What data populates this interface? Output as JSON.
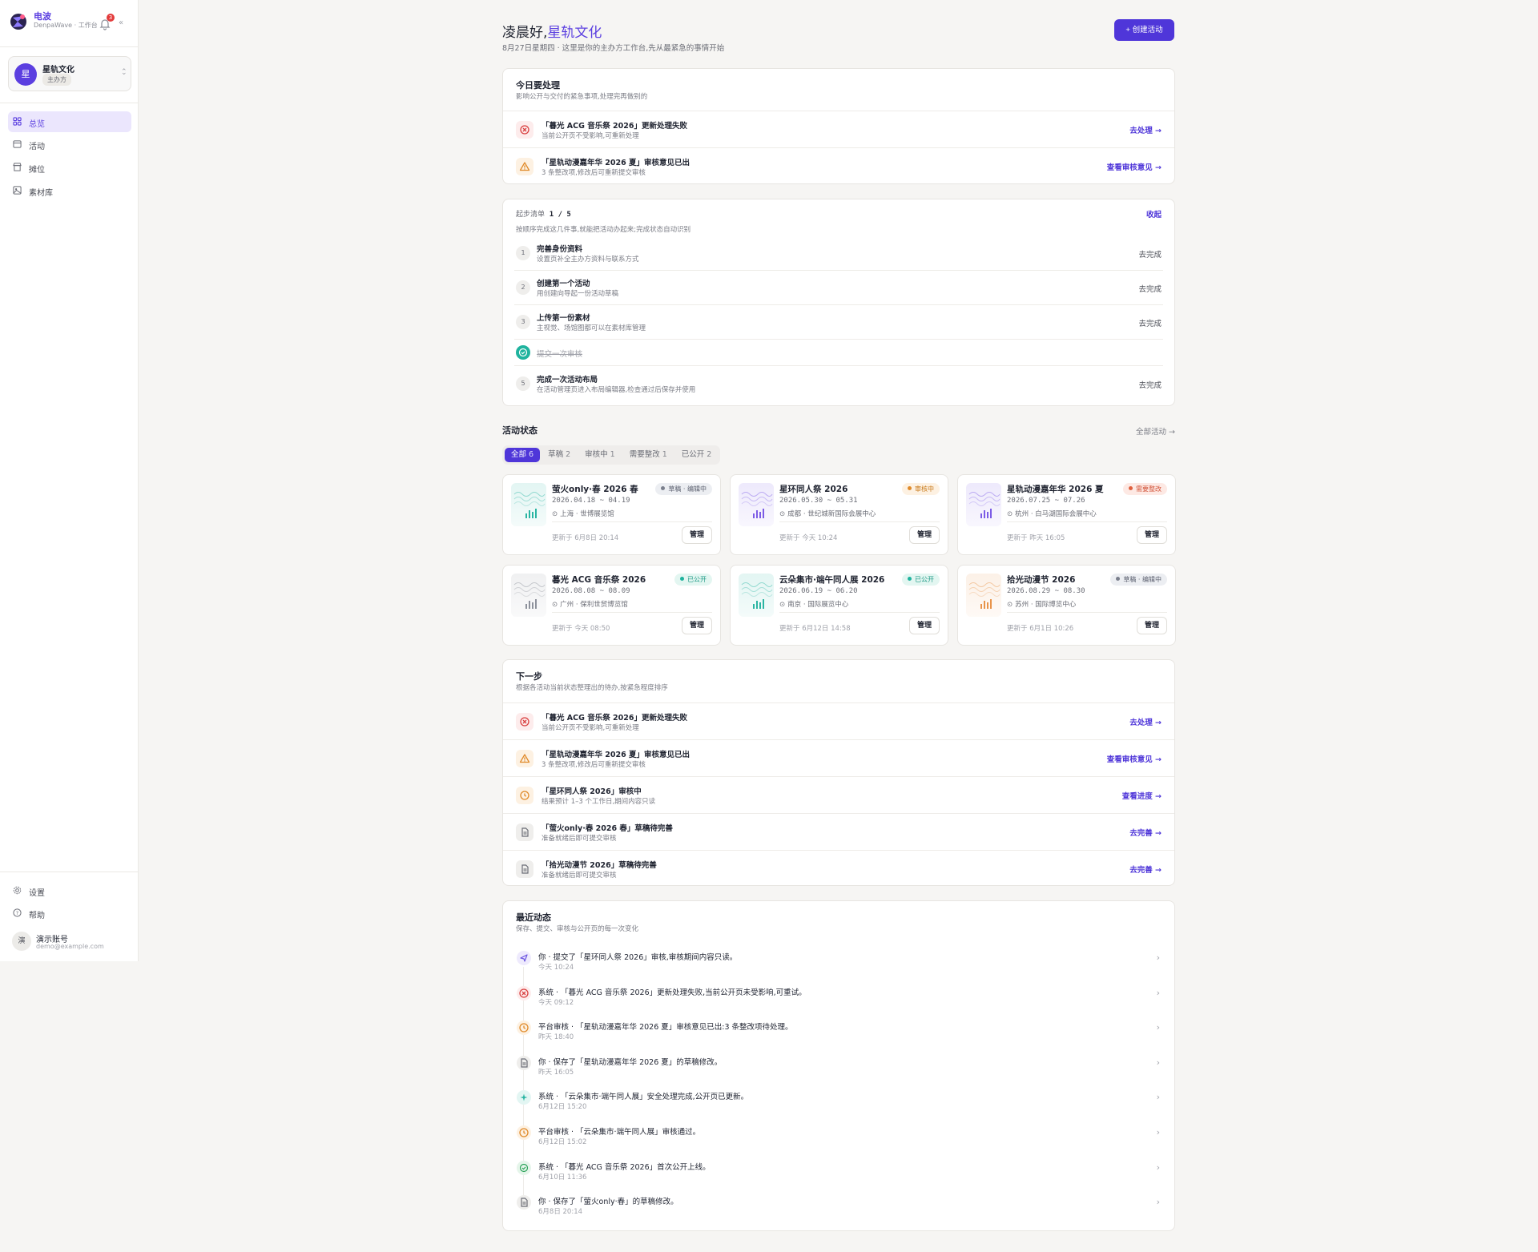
{
  "sidebar": {
    "brand_name": "电波",
    "brand_sub": "DenpaWave · 工作台",
    "notifications": "3",
    "org": {
      "avatar": "星",
      "name": "星轨文化",
      "role": "主办方"
    },
    "nav": [
      {
        "label": "总览",
        "icon": "grid-icon",
        "active": true
      },
      {
        "label": "活动",
        "icon": "calendar-icon"
      },
      {
        "label": "摊位",
        "icon": "store-icon"
      },
      {
        "label": "素材库",
        "icon": "image-icon"
      }
    ],
    "bottom": [
      {
        "label": "设置",
        "icon": "gear-icon"
      },
      {
        "label": "帮助",
        "icon": "help-icon"
      }
    ],
    "user": {
      "avatar": "演",
      "name": "演示账号",
      "email": "demo@example.com"
    }
  },
  "header": {
    "greeting": "凌晨好,",
    "org": "星轨文化",
    "subtitle": "8月27日星期四 · 这里是你的主办方工作台,先从最紧急的事情开始",
    "create_label": "+ 创建活动"
  },
  "today": {
    "title": "今日要处理",
    "subtitle": "影响公开与交付的紧急事项,处理完再做别的",
    "items": [
      {
        "title": "「暮光 ACG 音乐祭 2026」更新处理失败",
        "sub": "当前公开页不受影响,可重新处理",
        "action": "去处理 →",
        "icon": "error-icon"
      },
      {
        "title": "「星轨动漫嘉年华 2026 夏」审核意见已出",
        "sub": "3 条整改项,修改后可重新提交审核",
        "action": "查看审核意见 →",
        "icon": "warning-icon"
      }
    ]
  },
  "checklist": {
    "label": "起步清单",
    "progress": "1 / 5",
    "collapse": "收起",
    "subtitle": "按顺序完成这几件事,就能把活动办起来;完成状态自动识别",
    "steps": [
      {
        "num": "1",
        "title": "完善身份资料",
        "sub": "设置页补全主办方资料与联系方式",
        "action": "去完成"
      },
      {
        "num": "2",
        "title": "创建第一个活动",
        "sub": "用创建向导起一份活动草稿",
        "action": "去完成"
      },
      {
        "num": "3",
        "title": "上传第一份素材",
        "sub": "主视觉、场馆图都可以在素材库管理",
        "action": "去完成"
      },
      {
        "num": "",
        "title": "提交一次审核",
        "sub": "",
        "action": "",
        "done": true
      },
      {
        "num": "5",
        "title": "完成一次活动布局",
        "sub": "在活动管理页进入布局编辑器,检查通过后保存并使用",
        "action": "去完成"
      }
    ]
  },
  "activity_status": {
    "title": "活动状态",
    "all_link": "全部活动 →",
    "tabs": [
      {
        "label": "全部",
        "count": "6",
        "active": true
      },
      {
        "label": "草稿",
        "count": "2"
      },
      {
        "label": "审核中",
        "count": "1"
      },
      {
        "label": "需要整改",
        "count": "1"
      },
      {
        "label": "已公开",
        "count": "2"
      }
    ],
    "events": [
      {
        "name": "萤火only·春 2026 春",
        "status": "草稿 · 编辑中",
        "tone": "gray",
        "dates": "2026.04.18 ~ 04.19",
        "loc": "上海 · 世博展览馆",
        "updated": "更新于 6月8日 20:14",
        "manage": "管理",
        "thumb": "#2bb5a3"
      },
      {
        "name": "星环同人祭 2026",
        "status": "审核中",
        "tone": "orange",
        "dates": "2026.05.30 ~ 05.31",
        "loc": "成都 · 世纪城新国际会展中心",
        "updated": "更新于 今天 10:24",
        "manage": "管理",
        "thumb": "#7c5ce6"
      },
      {
        "name": "星轨动漫嘉年华 2026 夏",
        "status": "需要整改",
        "tone": "red",
        "dates": "2026.07.25 ~ 07.26",
        "loc": "杭州 · 白马湖国际会展中心",
        "updated": "更新于 昨天 16:05",
        "manage": "管理",
        "thumb": "#7c5ce6"
      },
      {
        "name": "暮光 ACG 音乐祭 2026",
        "status": "已公开",
        "tone": "green",
        "dates": "2026.08.08 ~ 08.09",
        "loc": "广州 · 保利世贸博览馆",
        "updated": "更新于 今天 08:50",
        "manage": "管理",
        "thumb": "#8e929c"
      },
      {
        "name": "云朵集市·端午同人展 2026",
        "status": "已公开",
        "tone": "green",
        "dates": "2026.06.19 ~ 06.20",
        "loc": "南京 · 国际展览中心",
        "updated": "更新于 6月12日 14:58",
        "manage": "管理",
        "thumb": "#2bb5a3"
      },
      {
        "name": "拾光动漫节 2026",
        "status": "草稿 · 编辑中",
        "tone": "gray",
        "dates": "2026.08.29 ~ 08.30",
        "loc": "苏州 · 国际博览中心",
        "updated": "更新于 6月1日 10:26",
        "manage": "管理",
        "thumb": "#e8944a"
      }
    ]
  },
  "next_steps": {
    "title": "下一步",
    "subtitle": "根据各活动当前状态整理出的待办,按紧急程度排序",
    "items": [
      {
        "title": "「暮光 ACG 音乐祭 2026」更新处理失败",
        "sub": "当前公开页不受影响,可重新处理",
        "action": "去处理 →",
        "icon": "error-icon"
      },
      {
        "title": "「星轨动漫嘉年华 2026 夏」审核意见已出",
        "sub": "3 条整改项,修改后可重新提交审核",
        "action": "查看审核意见 →",
        "icon": "warning-icon"
      },
      {
        "title": "「星环同人祭 2026」审核中",
        "sub": "结果预计 1–3 个工作日,期间内容只读",
        "action": "查看进度 →",
        "icon": "clock-icon"
      },
      {
        "title": "「萤火only·春 2026 春」草稿待完善",
        "sub": "准备就绪后即可提交审核",
        "action": "去完善 →",
        "icon": "document-icon"
      },
      {
        "title": "「拾光动漫节 2026」草稿待完善",
        "sub": "准备就绪后即可提交审核",
        "action": "去完善 →",
        "icon": "document-icon"
      }
    ]
  },
  "recent": {
    "title": "最近动态",
    "subtitle": "保存、提交、审核与公开页的每一次变化",
    "items": [
      {
        "text": "你 · 提交了「星环同人祭 2026」审核,审核期间内容只读。",
        "time": "今天 10:24",
        "icon": "send-icon",
        "color": "#6b55e0",
        "bg": "#eeeafd"
      },
      {
        "text": "系统 · 「暮光 ACG 音乐祭 2026」更新处理失败,当前公开页未受影响,可重试。",
        "time": "今天 09:12",
        "icon": "error-icon",
        "color": "#d94040",
        "bg": "#fdecec"
      },
      {
        "text": "平台审核 · 「星轨动漫嘉年华 2026 夏」审核意见已出:3 条整改项待处理。",
        "time": "昨天 18:40",
        "icon": "clock-icon",
        "color": "#e08a2a",
        "bg": "#fdf1e2"
      },
      {
        "text": "你 · 保存了「星轨动漫嘉年华 2026 夏」的草稿修改。",
        "time": "昨天 16:05",
        "icon": "document-icon",
        "color": "#6b6d76",
        "bg": "#efeeec"
      },
      {
        "text": "系统 · 「云朵集市·端午同人展」安全处理完成,公开页已更新。",
        "time": "6月12日 15:20",
        "icon": "sparkle-icon",
        "color": "#2bb5a3",
        "bg": "#e3f6f3"
      },
      {
        "text": "平台审核 · 「云朵集市·端午同人展」审核通过。",
        "time": "6月12日 15:02",
        "icon": "clock-icon",
        "color": "#e08a2a",
        "bg": "#fdf1e2"
      },
      {
        "text": "系统 · 「暮光 ACG 音乐祭 2026」首次公开上线。",
        "time": "6月10日 11:36",
        "icon": "check-icon",
        "color": "#2ca35a",
        "bg": "#e5f5ea"
      },
      {
        "text": "你 · 保存了「萤火only·春」的草稿修改。",
        "time": "6月8日 20:14",
        "icon": "document-icon",
        "color": "#6b6d76",
        "bg": "#efeeec"
      }
    ]
  }
}
